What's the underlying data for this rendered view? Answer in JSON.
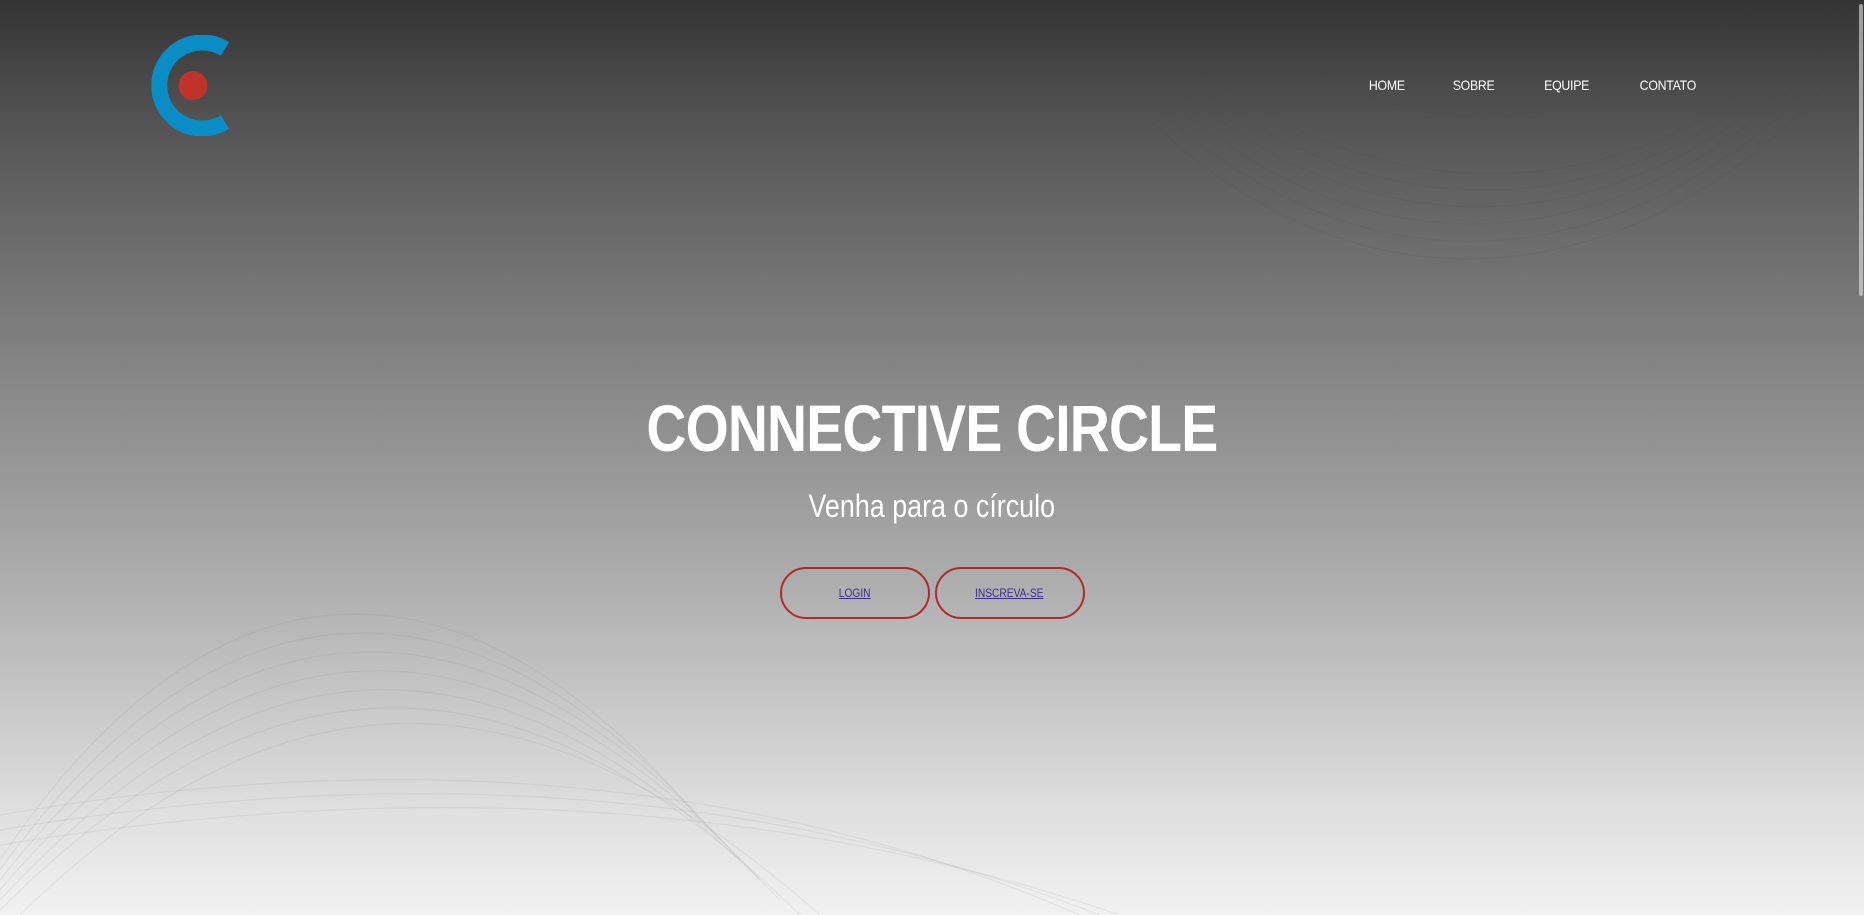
{
  "header": {
    "logo": {
      "name": "connective-circle-logo",
      "colors": {
        "ring": "#0a8dc4",
        "dot": "#c0332b"
      }
    },
    "nav": [
      {
        "label": "HOME"
      },
      {
        "label": "SOBRE"
      },
      {
        "label": "EQUIPE"
      },
      {
        "label": "CONTATO"
      }
    ]
  },
  "hero": {
    "title": "CONNECTIVE CIRCLE",
    "subtitle": "Venha para o círculo",
    "buttons": [
      {
        "label": "LOGIN"
      },
      {
        "label": "INSCREVA-SE"
      }
    ]
  },
  "colors": {
    "button_border": "#b3292b",
    "link_text": "#3c2a8a",
    "text": "#ffffff"
  }
}
